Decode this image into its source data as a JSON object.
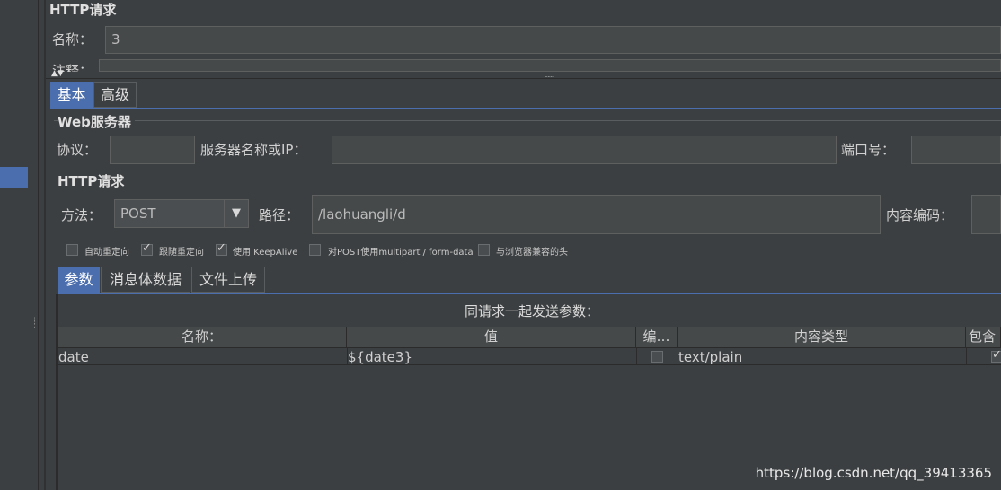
{
  "header": {
    "title": "HTTP请求"
  },
  "name_row": {
    "label": "名称：",
    "value": "3"
  },
  "comment_row": {
    "label": "注释："
  },
  "main_tabs": [
    {
      "label": "基本"
    },
    {
      "label": "高级"
    }
  ],
  "web_server": {
    "title": "Web服务器",
    "protocol_label": "协议：",
    "protocol_value": "",
    "server_label": "服务器名称或IP：",
    "server_value": "",
    "port_label": "端口号：",
    "port_value": ""
  },
  "http_request": {
    "title": "HTTP请求",
    "method_label": "方法：",
    "method_value": "POST",
    "path_label": "路径：",
    "path_value": "/laohuangli/d",
    "encoding_label": "内容编码："
  },
  "options": [
    {
      "label": "自动重定向",
      "checked": false
    },
    {
      "label": "跟随重定向",
      "checked": true
    },
    {
      "label": "使用 KeepAlive",
      "checked": true
    },
    {
      "label": "对POST使用multipart / form-data",
      "checked": false
    },
    {
      "label": "与浏览器兼容的头",
      "checked": false
    }
  ],
  "sub_tabs": [
    {
      "label": "参数"
    },
    {
      "label": "消息体数据"
    },
    {
      "label": "文件上传"
    }
  ],
  "params": {
    "caption": "同请求一起发送参数：",
    "columns": [
      "名称：",
      "值",
      "编…",
      "内容类型",
      "包含"
    ],
    "rows": [
      {
        "name": "date",
        "value": "${date3}",
        "encode": false,
        "content_type": "text/plain",
        "include": true
      }
    ]
  },
  "watermark": "https://blog.csdn.net/qq_39413365",
  "colors": {
    "accent": "#4b6eaf",
    "background": "#3c3f41"
  }
}
